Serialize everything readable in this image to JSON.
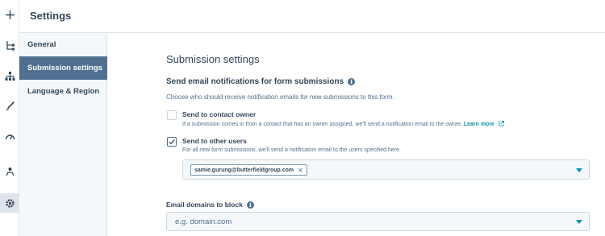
{
  "header": {
    "title": "Settings"
  },
  "rail": {
    "icons": [
      "plus-icon",
      "flow-icon",
      "hierarchy-icon",
      "brush-icon",
      "gauge-icon",
      "users-icon",
      "gear-icon"
    ]
  },
  "nav": {
    "items": [
      {
        "label": "General",
        "active": false
      },
      {
        "label": "Submission settings",
        "active": true
      },
      {
        "label": "Language & Region",
        "active": false
      }
    ]
  },
  "main": {
    "section_title": "Submission settings",
    "notifications": {
      "heading": "Send email notifications for form submissions",
      "description": "Choose who should receive notification emails for new submissions to this form.",
      "contact_owner": {
        "label": "Send to contact owner",
        "checked": false,
        "help": "If a submission comes in from a contact that has an owner assigned, we'll send a notification email to the owner.",
        "link": "Learn more"
      },
      "other_users": {
        "label": "Send to other users",
        "checked": true,
        "help": "For all new form submissions, we'll send a notification email to the users specified here.",
        "selected": [
          "samie.gurung@butterfieldgroup.com"
        ]
      }
    },
    "email_domains": {
      "label": "Email domains to block",
      "placeholder": "e.g. domain.com"
    }
  },
  "colors": {
    "accent": "#0091ae",
    "nav_active": "#516f90",
    "text": "#33475b"
  }
}
